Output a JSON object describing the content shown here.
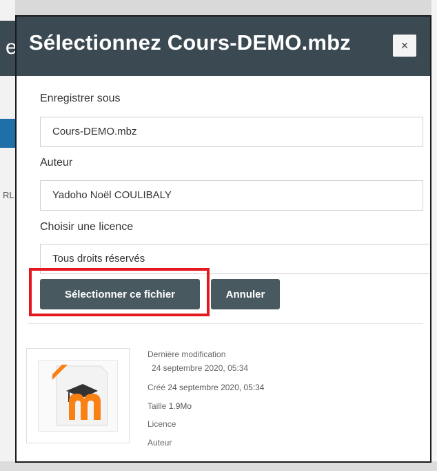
{
  "background": {
    "left_fragment_text": "RL"
  },
  "dialog": {
    "title": "Sélectionnez Cours-DEMO.mbz",
    "close_label": "×",
    "save_as": {
      "label": "Enregistrer sous",
      "value": "Cours-DEMO.mbz"
    },
    "author": {
      "label": "Auteur",
      "value": "Yadoho Noël COULIBALY"
    },
    "license": {
      "label": "Choisir une licence",
      "value": "Tous droits réservés"
    },
    "buttons": {
      "select": "Sélectionner ce fichier",
      "cancel": "Annuler"
    },
    "file_info": {
      "last_modified_label": "Dernière modification",
      "last_modified_value": "24 septembre 2020, 05:34",
      "created_label": "Créé",
      "created_value": "24 septembre 2020, 05:34",
      "size_label": "Taille",
      "size_value": "1.9Mo",
      "license_label": "Licence",
      "author_label": "Auteur"
    },
    "thumbnail_icon": "moodle-backup-file-icon"
  },
  "colors": {
    "header_bg": "#3b4a52",
    "button_bg": "#485960",
    "highlight": "#e3191f",
    "moodle_orange": "#f98012"
  }
}
